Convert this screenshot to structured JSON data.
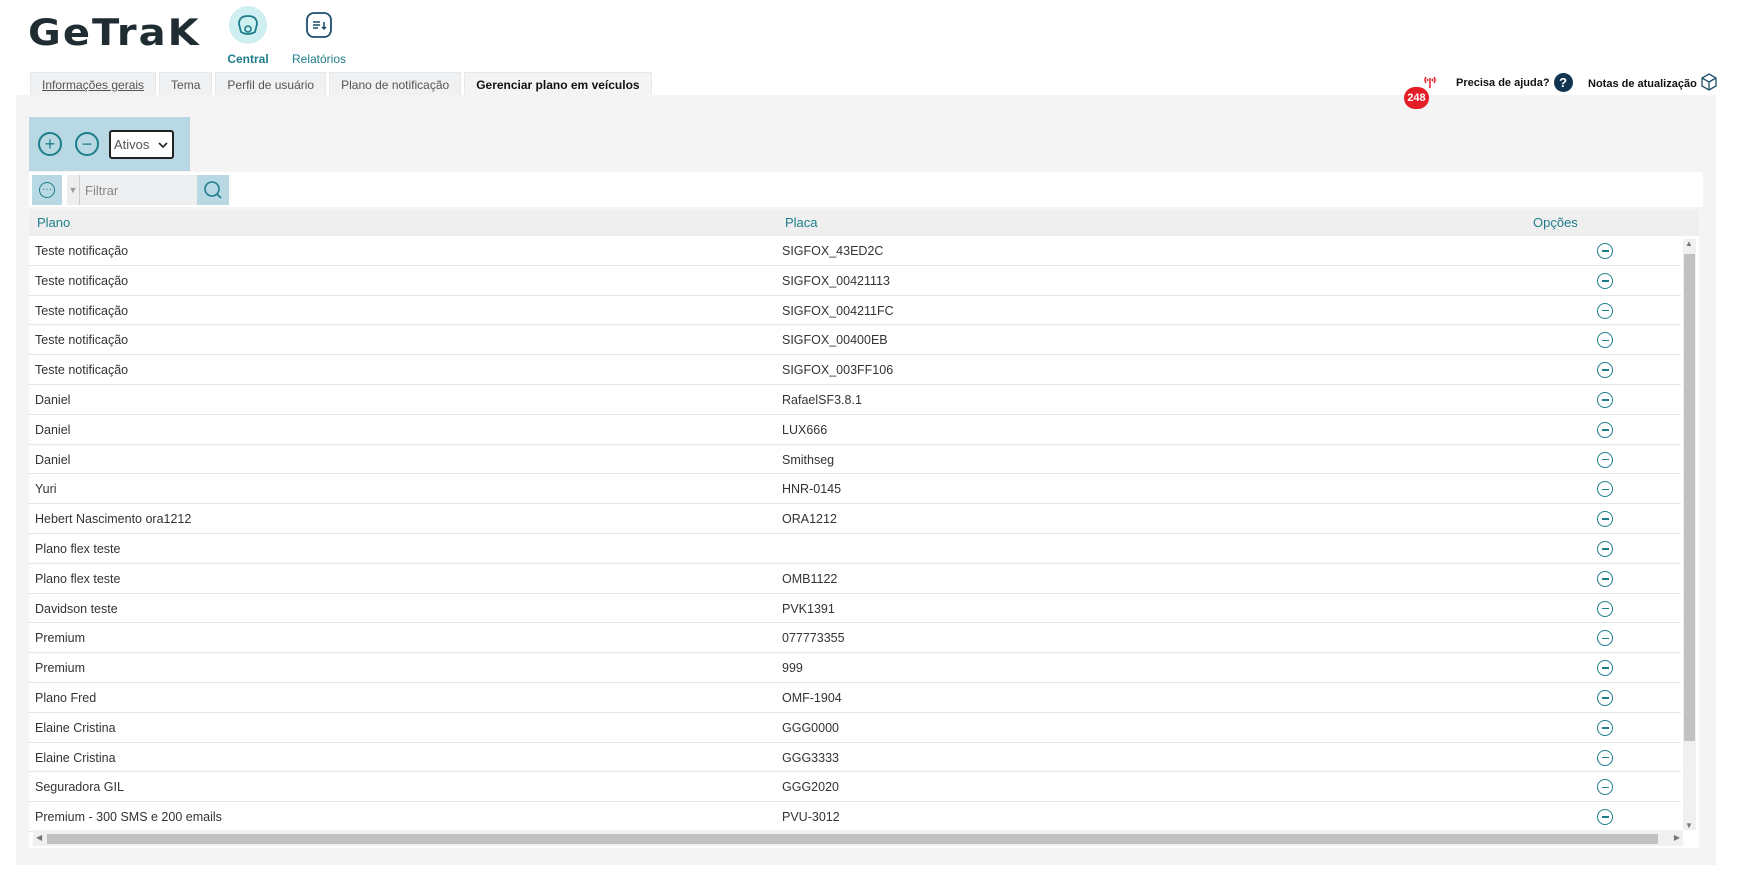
{
  "app": {
    "logo": "GeTraK"
  },
  "nav": [
    {
      "label": "Central",
      "icon": "central-icon",
      "active": true
    },
    {
      "label": "Relatórios",
      "icon": "reports-icon",
      "active": false
    }
  ],
  "tabs": [
    {
      "label": "Informações gerais"
    },
    {
      "label": "Tema"
    },
    {
      "label": "Perfil de usuário"
    },
    {
      "label": "Plano de notificação"
    },
    {
      "label": "Gerenciar plano em veículos"
    }
  ],
  "header": {
    "alerts_count": "248",
    "help_label": "Precisa de ajuda?",
    "help_glyph": "?",
    "notes_label": "Notas de atualização"
  },
  "toolbar": {
    "add_glyph": "+",
    "remove_glyph": "−",
    "status_value": "Ativos"
  },
  "filter": {
    "placeholder": "Filtrar",
    "options_glyph": "···"
  },
  "table": {
    "columns": {
      "plano": "Plano",
      "placa": "Placa",
      "opcoes": "Opções"
    },
    "rows": [
      {
        "plano": "Teste notificação",
        "placa": "SIGFOX_43ED2C"
      },
      {
        "plano": "Teste notificação",
        "placa": "SIGFOX_00421113"
      },
      {
        "plano": "Teste notificação",
        "placa": "SIGFOX_004211FC"
      },
      {
        "plano": "Teste notificação",
        "placa": "SIGFOX_00400EB"
      },
      {
        "plano": "Teste notificação",
        "placa": "SIGFOX_003FF106"
      },
      {
        "plano": "Daniel",
        "placa": "RafaelSF3.8.1"
      },
      {
        "plano": "Daniel",
        "placa": "LUX666"
      },
      {
        "plano": "Daniel",
        "placa": "Smithseg"
      },
      {
        "plano": "Yuri",
        "placa": "HNR-0145"
      },
      {
        "plano": "Hebert Nascimento ora1212",
        "placa": "ORA1212"
      },
      {
        "plano": "Plano flex teste",
        "placa": ""
      },
      {
        "plano": "Plano flex teste",
        "placa": "OMB1122"
      },
      {
        "plano": "Davidson teste",
        "placa": "PVK1391"
      },
      {
        "plano": "Premium",
        "placa": "077773355"
      },
      {
        "plano": "Premium",
        "placa": "999"
      },
      {
        "plano": "Plano Fred",
        "placa": "OMF-1904"
      },
      {
        "plano": "Elaine Cristina",
        "placa": "GGG0000"
      },
      {
        "plano": "Elaine Cristina",
        "placa": "GGG3333"
      },
      {
        "plano": "Seguradora GIL",
        "placa": "GGG2020"
      },
      {
        "plano": "Premium - 300 SMS e 200 emails",
        "placa": "PVU-3012"
      }
    ]
  },
  "colors": {
    "accent": "#1d7d8a",
    "badge": "#e41e26",
    "toolbar_bg": "#b8d8e3"
  }
}
